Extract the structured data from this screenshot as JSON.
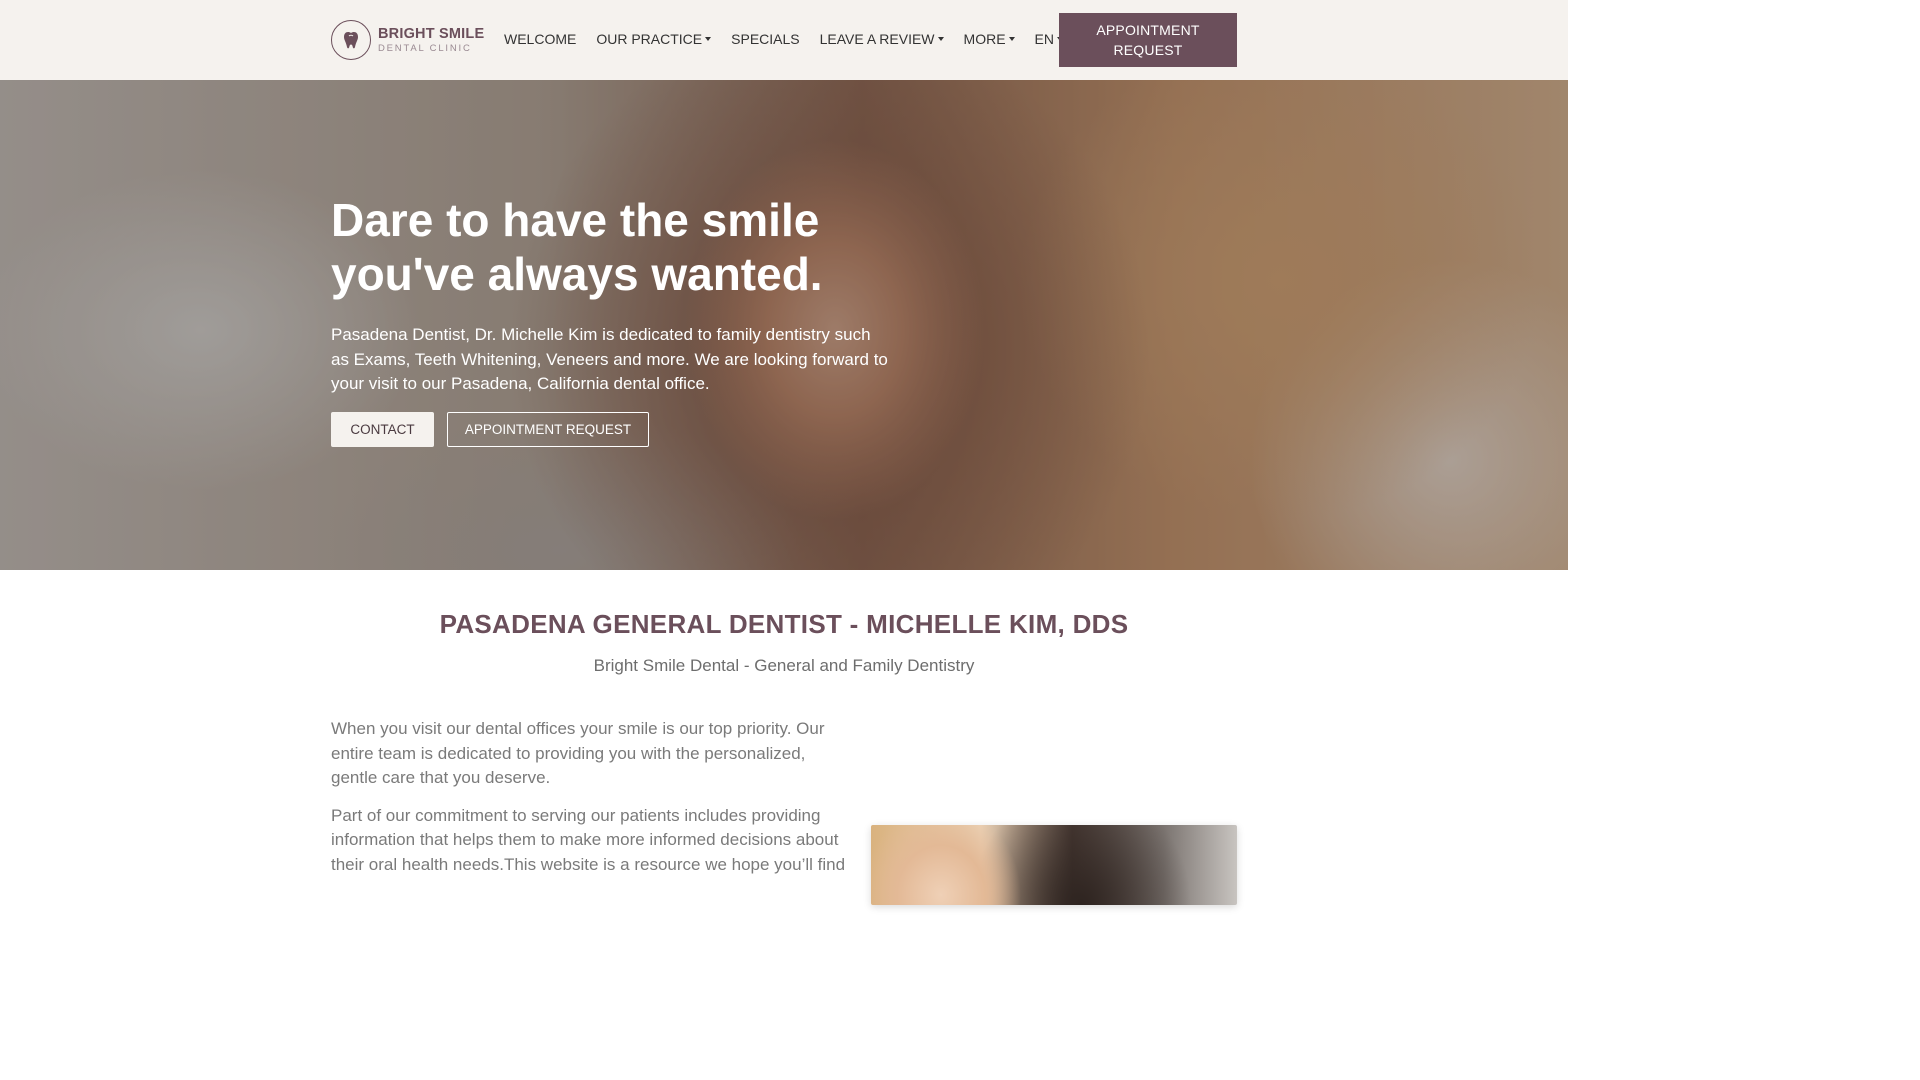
{
  "header": {
    "logo": {
      "name": "BRIGHT SMILE",
      "subtitle": "DENTAL CLINIC",
      "icon": "tooth-icon"
    },
    "nav": [
      {
        "label": "WELCOME",
        "dropdown": false
      },
      {
        "label": "OUR PRACTICE",
        "dropdown": true
      },
      {
        "label": "SPECIALS",
        "dropdown": false
      },
      {
        "label": "LEAVE A REVIEW",
        "dropdown": true
      },
      {
        "label": "MORE",
        "dropdown": true
      },
      {
        "label": "EN",
        "dropdown": true
      }
    ],
    "appointment_button": {
      "line1": "APPOINTMENT",
      "line2": "REQUEST"
    }
  },
  "hero": {
    "title_line1": "Dare to have the smile",
    "title_line2": "you've always wanted.",
    "text": "Pasadena Dentist, Dr. Michelle Kim is dedicated to family dentistry such as Exams, Teeth Whitening, Veneers and more. We are looking forward to your visit to our Pasadena, California dental office.",
    "contact_label": "CONTACT",
    "appointment_label": "APPOINTMENT REQUEST"
  },
  "main": {
    "title": "PASADENA GENERAL DENTIST - MICHELLE KIM, DDS",
    "subtitle": "Bright Smile Dental - General and Family Dentistry",
    "paragraphs": [
      "When you visit our dental offices your smile is our top priority. Our entire team is dedicated to providing you with the personalized, gentle care that you deserve.",
      "Part of our commitment to serving our patients includes providing information that helps them to make more informed decisions about their oral health needs.This website is a resource we hope you’ll find"
    ]
  },
  "colors": {
    "brand": "#6b4f5b",
    "header_bg": "#f5f2ee",
    "body_text": "#7a7a7a"
  }
}
